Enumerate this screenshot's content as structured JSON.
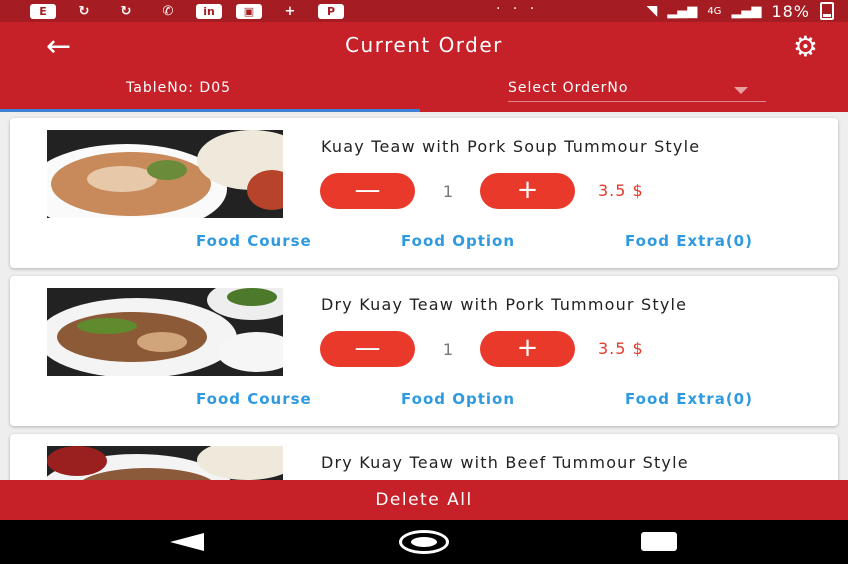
{
  "status_bar": {
    "left_icons": [
      "E",
      "↻",
      "↻",
      "✆",
      "in",
      "▣",
      "+",
      "P"
    ],
    "dots": "· · ·",
    "network": "4G",
    "battery": "18%"
  },
  "appbar": {
    "title": "Current Order",
    "back_icon": "←",
    "settings_icon": "⚙",
    "table_no": "TableNo: D05",
    "order_select": "Select OrderNo"
  },
  "items": [
    {
      "name": "Kuay Teaw with Pork Soup Tummour Style",
      "qty": "1",
      "price": "3.5 $",
      "minus": "—",
      "plus": "+",
      "links": [
        "Food Course",
        "Food Option",
        "Food Extra(0)"
      ]
    },
    {
      "name": "Dry Kuay Teaw with Pork Tummour Style",
      "qty": "1",
      "price": "3.5 $",
      "minus": "—",
      "plus": "+",
      "links": [
        "Food Course",
        "Food Option",
        "Food Extra(0)"
      ]
    },
    {
      "name": "Dry Kuay Teaw with Beef Tummour Style"
    }
  ],
  "delete_all": "Delete All",
  "colors": {
    "primary": "#c62128",
    "accent": "#e8392b",
    "link": "#2f9ae0",
    "tab_indicator": "#3b82d6"
  }
}
